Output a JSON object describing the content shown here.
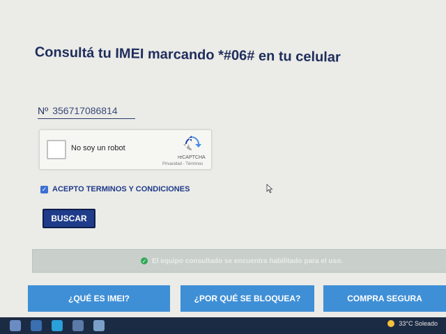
{
  "title": "Consultá tu IMEI marcando *#06# en tu celular",
  "imei": {
    "prefix": "Nº",
    "value": "356717086814"
  },
  "captcha": {
    "label": "No soy un robot",
    "brand": "reCAPTCHA",
    "links": "Privacidad - Términos"
  },
  "terms_label": "ACEPTO TERMINOS Y CONDICIONES",
  "search_label": "BUSCAR",
  "status_message": "El equipo consultado se encuentra habilitado para el uso.",
  "nav": [
    {
      "label": "¿QUÉ ES IMEI?"
    },
    {
      "label": "¿POR QUÉ SE BLOQUEA?"
    },
    {
      "label": "COMPRA SEGURA"
    }
  ],
  "taskbar": {
    "weather": "33°C  Soleado"
  },
  "colors": {
    "primary": "#1f3c8a",
    "nav_button": "#3f8fd6",
    "success": "#2eaa55",
    "title": "#1e2d5c"
  }
}
